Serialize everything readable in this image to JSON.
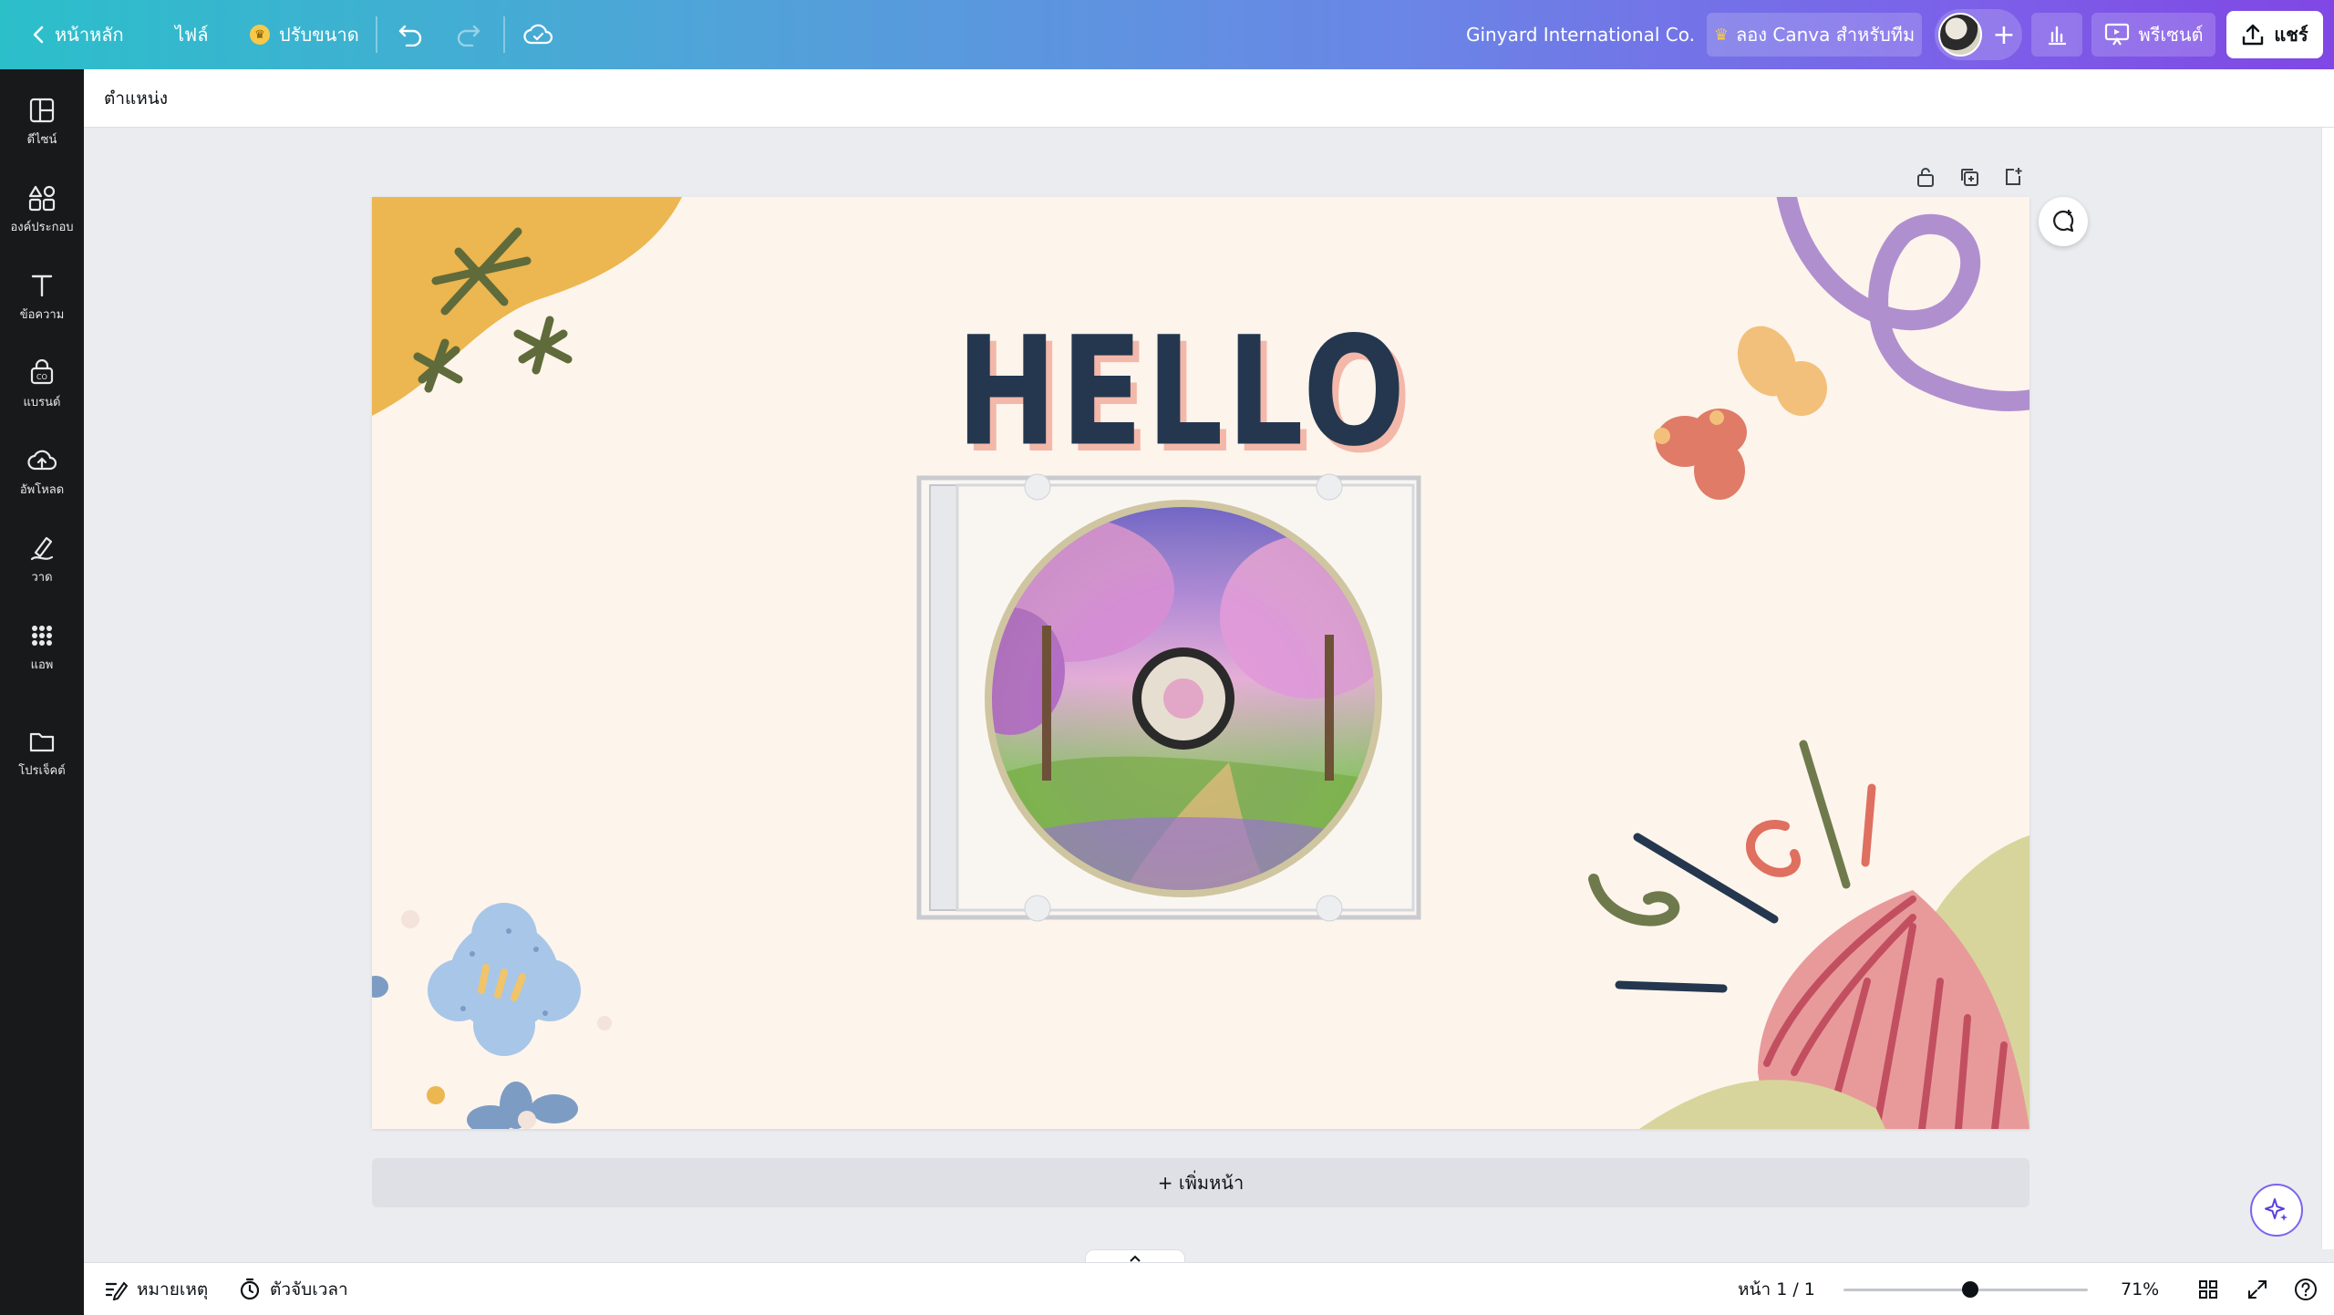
{
  "topbar": {
    "back_label": "หน้าหลัก",
    "file_label": "ไฟล์",
    "resize_label": "ปรับขนาด",
    "team_name": "Ginyard International Co.",
    "try_team_label": "ลอง Canva สำหรับทีม",
    "present_label": "พรีเซนต์",
    "share_label": "แชร์"
  },
  "siderail": {
    "items": [
      {
        "label": "ดีไซน์",
        "icon": "layout-icon"
      },
      {
        "label": "องค์ประกอบ",
        "icon": "shapes-icon"
      },
      {
        "label": "ข้อความ",
        "icon": "text-icon"
      },
      {
        "label": "แบรนด์",
        "icon": "brand-icon"
      },
      {
        "label": "อัพโหลด",
        "icon": "upload-icon"
      },
      {
        "label": "วาด",
        "icon": "draw-icon"
      },
      {
        "label": "แอพ",
        "icon": "apps-icon"
      },
      {
        "label": "โปรเจ็คต์",
        "icon": "folder-icon"
      }
    ]
  },
  "context": {
    "position_label": "ตำแหน่ง"
  },
  "canvas": {
    "heading": "HELLO",
    "add_page_label": "+ เพิ่มหน้า"
  },
  "bottombar": {
    "notes_label": "หมายเหตุ",
    "timer_label": "ตัวจับเวลา",
    "page_indicator": "หน้า 1 / 1",
    "zoom_label": "71%",
    "zoom_percent": 71
  },
  "colors": {
    "topbar_start": "#2bbfca",
    "topbar_end": "#8047e4",
    "rail_bg": "#18191b",
    "page_bg": "#fdf4ec",
    "hello_text": "#24374f",
    "hello_shadow": "#f3b8a9"
  }
}
